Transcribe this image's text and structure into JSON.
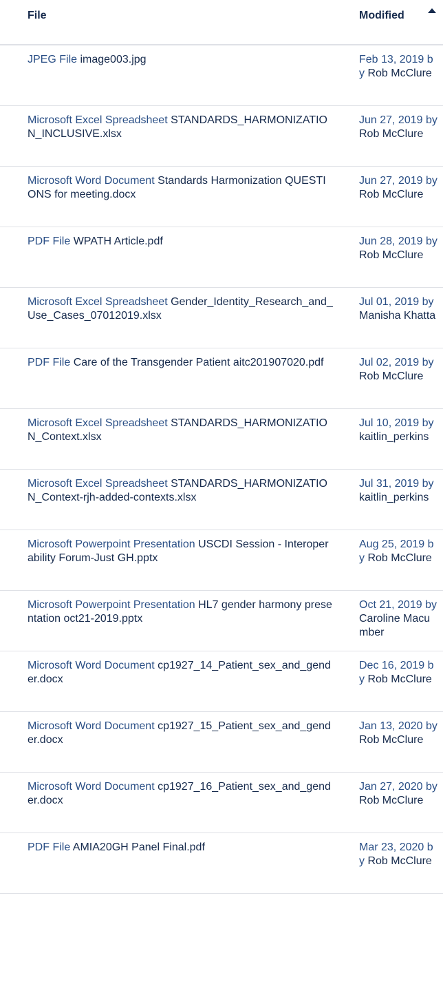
{
  "header": {
    "file_label": "File",
    "modified_label": "Modified",
    "sort_icon": "sort-ascending-icon"
  },
  "rows": [
    {
      "type": "JPEG File",
      "name": "image003.jpg",
      "date": "Feb 13, 2019",
      "by": "by",
      "author": "Rob McClure"
    },
    {
      "type": "Microsoft Excel Spreadsheet",
      "name": "STANDARDS_HARMONIZATION_INCLUSIVE.xlsx",
      "date": "Jun 27, 2019",
      "by": "by",
      "author": "Rob McClure"
    },
    {
      "type": "Microsoft Word Document",
      "name": "Standards Harmonization QUESTIONS for meeting.docx",
      "date": "Jun 27, 2019",
      "by": "by",
      "author": "Rob McClure"
    },
    {
      "type": "PDF File",
      "name": "WPATH Article.pdf",
      "date": "Jun 28, 2019",
      "by": "by",
      "author": "Rob McClure"
    },
    {
      "type": "Microsoft Excel Spreadsheet",
      "name": "Gender_Identity_Research_and_Use_Cases_07012019.xlsx",
      "date": "Jul 01, 2019",
      "by": "by",
      "author": "Manisha Khatta"
    },
    {
      "type": "PDF File",
      "name": "Care of the Transgender Patient aitc201907020.pdf",
      "date": "Jul 02, 2019",
      "by": "by",
      "author": "Rob McClure"
    },
    {
      "type": "Microsoft Excel Spreadsheet",
      "name": "STANDARDS_HARMONIZATION_Context.xlsx",
      "date": "Jul 10, 2019",
      "by": "by",
      "author": "kaitlin_perkins"
    },
    {
      "type": "Microsoft Excel Spreadsheet",
      "name": "STANDARDS_HARMONIZATION_Context-rjh-added-contexts.xlsx",
      "date": "Jul 31, 2019",
      "by": "by",
      "author": "kaitlin_perkins"
    },
    {
      "type": "Microsoft Powerpoint Presentation",
      "name": "USCDI Session - Interoperability Forum-Just GH.pptx",
      "date": "Aug 25, 2019",
      "by": "by",
      "author": "Rob McClure"
    },
    {
      "type": "Microsoft Powerpoint Presentation",
      "name": "HL7 gender harmony presentation oct21-2019.pptx",
      "date": "Oct 21, 2019",
      "by": "by",
      "author": "Caroline Macumber"
    },
    {
      "type": "Microsoft Word Document",
      "name": "cp1927_14_Patient_sex_and_gender.docx",
      "date": "Dec 16, 2019",
      "by": "by",
      "author": "Rob McClure"
    },
    {
      "type": "Microsoft Word Document",
      "name": "cp1927_15_Patient_sex_and_gender.docx",
      "date": "Jan 13, 2020",
      "by": "by",
      "author": "Rob McClure"
    },
    {
      "type": "Microsoft Word Document",
      "name": "cp1927_16_Patient_sex_and_gender.docx",
      "date": "Jan 27, 2020",
      "by": "by",
      "author": "Rob McClure"
    },
    {
      "type": "PDF File",
      "name": "AMIA20GH Panel Final.pdf",
      "date": "Mar 23, 2020",
      "by": "by",
      "author": "Rob McClure"
    }
  ]
}
